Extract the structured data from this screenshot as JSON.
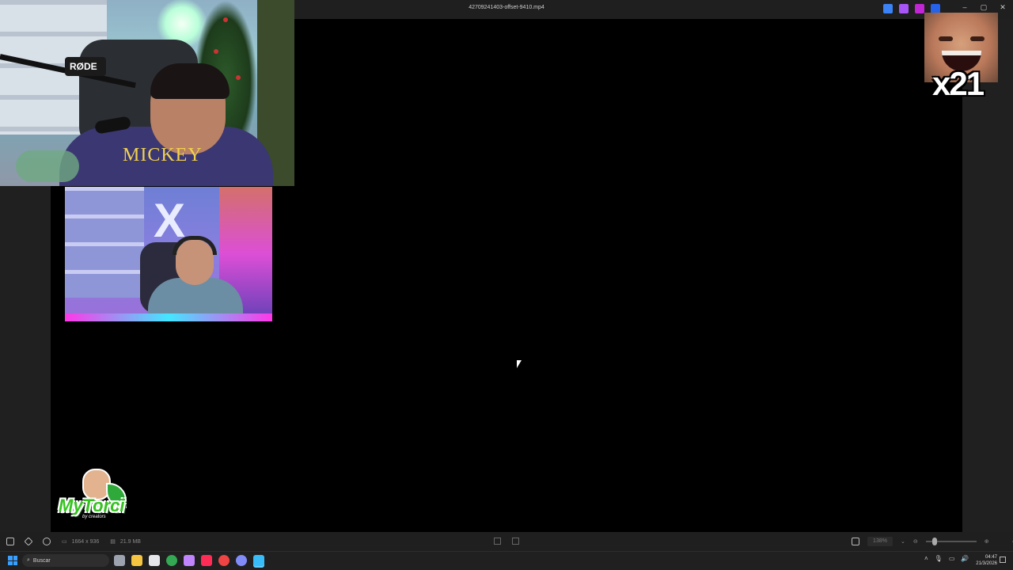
{
  "window": {
    "title": "42709241403-offset-9410.mp4",
    "controls": [
      "–",
      "▢",
      "✕"
    ]
  },
  "titlebar_icons": [
    {
      "name": "pen-icon",
      "color": "#3b82f6"
    },
    {
      "name": "pin-icon",
      "color": "#a855f7"
    },
    {
      "name": "clapper-icon",
      "color": "#c026d3"
    },
    {
      "name": "cloud-icon",
      "color": "#2563eb"
    }
  ],
  "overlays": {
    "cam1_shirt_text": "MICKEY",
    "cam1_mic_brand": "RØDE",
    "cam2_letter": "X",
    "logo_text": "MyTorci",
    "logo_sub": "by creators",
    "meme_counter": "x21"
  },
  "statusbar": {
    "resolution": "1664 x 936",
    "size": "21.9 MB",
    "zoom": "138%"
  },
  "taskbar": {
    "search_placeholder": "Buscar",
    "apps": [
      {
        "name": "task-view-icon",
        "color": "#9ca3af"
      },
      {
        "name": "file-explorer-icon",
        "color": "#f5c542"
      },
      {
        "name": "store-icon",
        "color": "#e5e7eb"
      },
      {
        "name": "chrome-icon",
        "color": "#34a853"
      },
      {
        "name": "obs-icon",
        "color": "#c084fc"
      },
      {
        "name": "tiktok-icon",
        "color": "#ff2d55"
      },
      {
        "name": "opera-icon",
        "color": "#ef4444"
      },
      {
        "name": "messenger-icon",
        "color": "#818cf8"
      },
      {
        "name": "photos-icon",
        "color": "#38bdf8"
      }
    ],
    "time": "04:47",
    "date": "21/3/2026"
  }
}
